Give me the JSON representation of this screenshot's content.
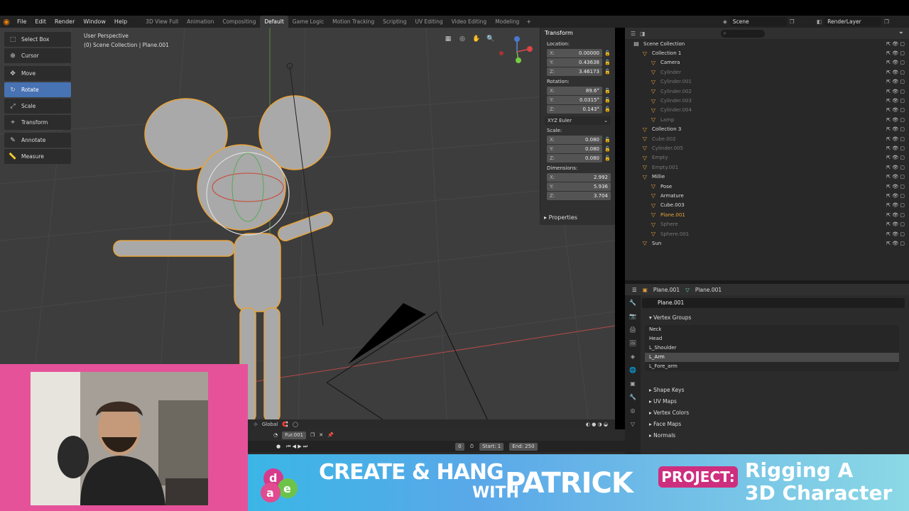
{
  "app": {
    "menu": [
      "File",
      "Edit",
      "Render",
      "Window",
      "Help"
    ],
    "workspaces": [
      "3D View Full",
      "Animation",
      "Compositing",
      "Default",
      "Game Logic",
      "Motion Tracking",
      "Scripting",
      "UV Editing",
      "Video Editing",
      "Modeling"
    ],
    "active_workspace": "Default",
    "scene": "Scene",
    "render_layer": "RenderLayer"
  },
  "viewport": {
    "view_label": "User Perspective",
    "selection_label": "(0) Scene Collection | Plane.001",
    "tools": [
      "Select Box",
      "Cursor",
      "Move",
      "Rotate",
      "Scale",
      "Transform",
      "Annotate",
      "Measure"
    ],
    "active_tool": "Rotate",
    "orientation": "Global"
  },
  "transform": {
    "title": "Transform",
    "location_label": "Location:",
    "location": {
      "x": "0.00000",
      "y": "0.43638",
      "z": "3.46173"
    },
    "rotation_label": "Rotation:",
    "rotation": {
      "x": "89.6°",
      "y": "0.0315°",
      "z": "0.143°"
    },
    "rotation_mode": "XYZ Euler",
    "scale_label": "Scale:",
    "scale": {
      "x": "0.080",
      "y": "0.080",
      "z": "0.080"
    },
    "dimensions_label": "Dimensions:",
    "dimensions": {
      "x": "2.992",
      "y": "5.936",
      "z": "3.704"
    },
    "properties_label": "Properties",
    "axis": {
      "x": "X:",
      "y": "Y:",
      "z": "Z:"
    }
  },
  "outliner": {
    "rows": [
      {
        "label": "Scene Collection",
        "indent": 0,
        "dim": false
      },
      {
        "label": "Collection 1",
        "indent": 1,
        "dim": false
      },
      {
        "label": "Camera",
        "indent": 2,
        "dim": false
      },
      {
        "label": "Cylinder",
        "indent": 2,
        "dim": true
      },
      {
        "label": "Cylinder.001",
        "indent": 2,
        "dim": true
      },
      {
        "label": "Cylinder.002",
        "indent": 2,
        "dim": true
      },
      {
        "label": "Cylinder.003",
        "indent": 2,
        "dim": true
      },
      {
        "label": "Cylinder.004",
        "indent": 2,
        "dim": true
      },
      {
        "label": "Lamp",
        "indent": 2,
        "dim": true
      },
      {
        "label": "Collection 3",
        "indent": 1,
        "dim": false
      },
      {
        "label": "Cube.002",
        "indent": 1,
        "dim": true
      },
      {
        "label": "Cylinder.005",
        "indent": 1,
        "dim": true
      },
      {
        "label": "Empty",
        "indent": 1,
        "dim": true
      },
      {
        "label": "Empty.001",
        "indent": 1,
        "dim": true
      },
      {
        "label": "Millie",
        "indent": 1,
        "dim": false
      },
      {
        "label": "Pose",
        "indent": 2,
        "dim": false
      },
      {
        "label": "Armature",
        "indent": 2,
        "dim": false
      },
      {
        "label": "Cube.003",
        "indent": 2,
        "dim": false
      },
      {
        "label": "Plane.001",
        "indent": 2,
        "dim": false
      },
      {
        "label": "Sphere",
        "indent": 2,
        "dim": true
      },
      {
        "label": "Sphere.001",
        "indent": 2,
        "dim": true
      },
      {
        "label": "Sun",
        "indent": 1,
        "dim": false
      }
    ]
  },
  "properties": {
    "header_object": "Plane.001",
    "header_data": "Plane.001",
    "data_name": "Plane.001",
    "vertex_groups_label": "Vertex Groups",
    "vertex_groups": [
      "Neck",
      "Head",
      "L_Shoulder",
      "L_Arm",
      "L_Fore_arm"
    ],
    "selected_group": "L_Arm",
    "collapsed_sections": [
      "Shape Keys",
      "UV Maps",
      "Vertex Colors",
      "Face Maps",
      "Normals"
    ]
  },
  "timeline": {
    "action": "Fur.001",
    "current_frame": "0",
    "start_label": "Start:",
    "start": "1",
    "end_label": "End:",
    "end": "250"
  },
  "banner": {
    "line1": "CREATE & HANG",
    "with": "WITH",
    "name": "PATRICK",
    "project_label": "PROJECT:",
    "title1": "Rigging A",
    "title2": "3D Character",
    "logo_letters": [
      "d",
      "a",
      "e"
    ]
  },
  "colors": {
    "accent": "#4772b3",
    "selection": "#e8a33a",
    "banner_pink": "#ce2e7e",
    "frame_pink": "#e6529a"
  }
}
